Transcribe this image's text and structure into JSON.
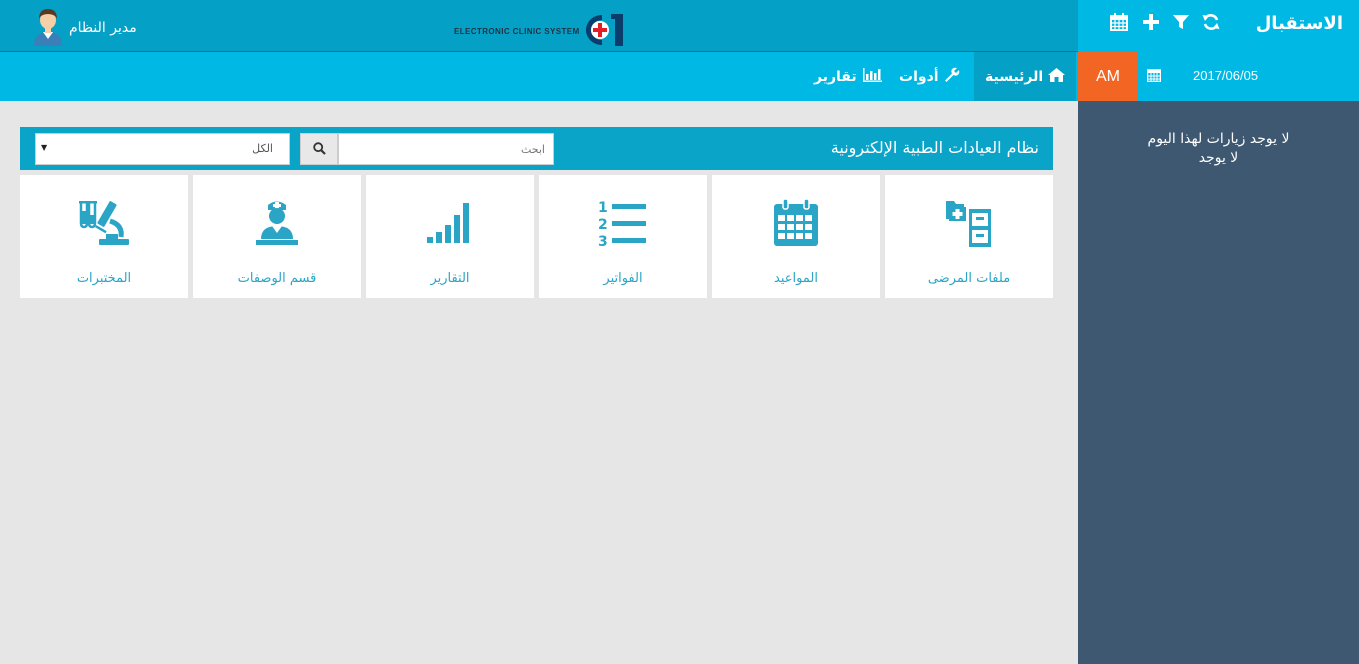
{
  "colors": {
    "primary": "#00b8e4",
    "header_dark": "#05a0c6",
    "sidebar_bg": "#3d5870",
    "am_badge": "#f26522",
    "tile_icon": "#2aa5c6",
    "page_bg": "#e6e6e6"
  },
  "header": {
    "user_name": "مدير النظام",
    "user_icon": "user-avatar-icon",
    "logo_text": "ELECTRONIC CLINIC SYSTEM"
  },
  "nav": {
    "items": [
      {
        "label": "الرئيسية",
        "icon": "home-icon"
      },
      {
        "label": "أدوات",
        "icon": "wrench-icon"
      },
      {
        "label": "تقارير",
        "icon": "bar-chart-icon"
      }
    ]
  },
  "sidebar": {
    "title": "الاستقبال",
    "toolbar_icons": [
      "refresh-icon",
      "filter-icon",
      "plus-icon",
      "calendar-icon"
    ],
    "am_label": "AM",
    "date": "2017/06/05",
    "no_visits": "لا يوجد زيارات لهذا اليوم",
    "none": "لا يوجد"
  },
  "main": {
    "title": "نظام العيادات الطبية الإلكترونية",
    "search_placeholder": "ابحث",
    "filter_value": "الكل",
    "tiles": [
      {
        "label": "ملفات المرضى",
        "icon": "patient-files-icon"
      },
      {
        "label": "المواعيد",
        "icon": "calendar-icon"
      },
      {
        "label": "الفواتير",
        "icon": "numbered-list-icon"
      },
      {
        "label": "التقارير",
        "icon": "signal-bars-icon"
      },
      {
        "label": "قسم الوصفات",
        "icon": "nurse-icon"
      },
      {
        "label": "المختبرات",
        "icon": "microscope-icon"
      }
    ]
  }
}
